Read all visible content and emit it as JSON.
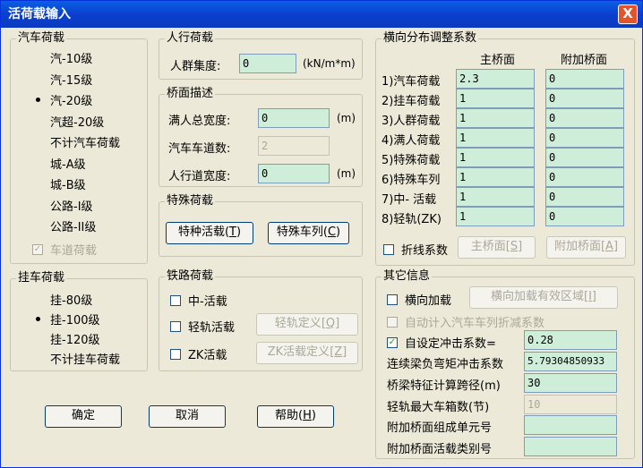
{
  "title": "活荷载输入",
  "close_glyph": "X",
  "vehicle": {
    "legend": "汽车荷载",
    "options": [
      "汽-10级",
      "汽-15级",
      "汽-20级",
      "汽超-20级",
      "不计汽车荷载",
      "城-A级",
      "城-B级",
      "公路-I级",
      "公路-II级"
    ],
    "selected_index": 2,
    "lane_load_label": "车道荷载",
    "lane_load_checked": true
  },
  "pedestrian": {
    "legend": "人行荷载",
    "crowd_label": "人群集度:",
    "crowd_value": "0",
    "crowd_unit": "(kN/m*m)"
  },
  "deck": {
    "legend": "桥面描述",
    "full_width_label": "满人总宽度:",
    "full_width_value": "0",
    "full_width_unit": "(m)",
    "lanes_label": "汽车车道数:",
    "lanes_value": "2",
    "sidewalk_label": "人行道宽度:",
    "sidewalk_value": "0",
    "sidewalk_unit": "(m)"
  },
  "special": {
    "legend": "特殊荷载",
    "special_live_btn": "特种活载",
    "special_live_key": "T",
    "special_train_btn": "特殊车列",
    "special_train_key": "C"
  },
  "trailer": {
    "legend": "挂车荷载",
    "options": [
      "挂-80级",
      "挂-100级",
      "挂-120级",
      "不计挂车荷载"
    ],
    "selected_index": 1
  },
  "railway": {
    "legend": "铁路荷载",
    "zhong_label": "中-活载",
    "light_rail_label": "轻轨活载",
    "light_rail_btn": "轻轨定义",
    "light_rail_key": "Q",
    "zk_label": "ZK活载",
    "zk_btn": "ZK活载定义",
    "zk_key": "Z"
  },
  "distribution": {
    "legend": "横向分布调整系数",
    "col_main": "主桥面",
    "col_extra": "附加桥面",
    "rows": [
      {
        "label": "1)汽车荷载",
        "main": "2.3",
        "extra": "0"
      },
      {
        "label": "2)挂车荷载",
        "main": "1",
        "extra": "0"
      },
      {
        "label": "3)人群荷载",
        "main": "1",
        "extra": "0"
      },
      {
        "label": "4)满人荷载",
        "main": "1",
        "extra": "0"
      },
      {
        "label": "5)特殊荷载",
        "main": "1",
        "extra": "0"
      },
      {
        "label": "6)特殊车列",
        "main": "1",
        "extra": "0"
      },
      {
        "label": "7)中- 活载",
        "main": "1",
        "extra": "0"
      },
      {
        "label": "8)轻轨(ZK)",
        "main": "1",
        "extra": "0"
      }
    ],
    "polyline_label": "折线系数",
    "main_btn": "主桥面",
    "main_key": "S",
    "extra_btn": "附加桥面",
    "extra_key": "A"
  },
  "other": {
    "legend": "其它信息",
    "lateral_label": "横向加载",
    "lateral_btn": "横向加载有效区域",
    "lateral_key": "I",
    "auto_reduce_label": "自动计入汽车车列折减系数",
    "custom_impact_label": "自设定冲击系数=",
    "custom_impact_value": "0.28",
    "continuous_label": "连续梁负弯矩冲击系数",
    "continuous_value": "5.79304850933",
    "span_label": "桥梁特征计算跨径(m)",
    "span_value": "30",
    "max_boxes_label": "轻轨最大车箱数(节)",
    "max_boxes_value": "10",
    "unit_no_label": "附加桥面组成单元号",
    "unit_no_value": "",
    "live_cat_label": "附加桥面活载类别号",
    "live_cat_value": ""
  },
  "buttons": {
    "ok": "确定",
    "cancel": "取消",
    "help": "帮助",
    "help_key": "H"
  }
}
